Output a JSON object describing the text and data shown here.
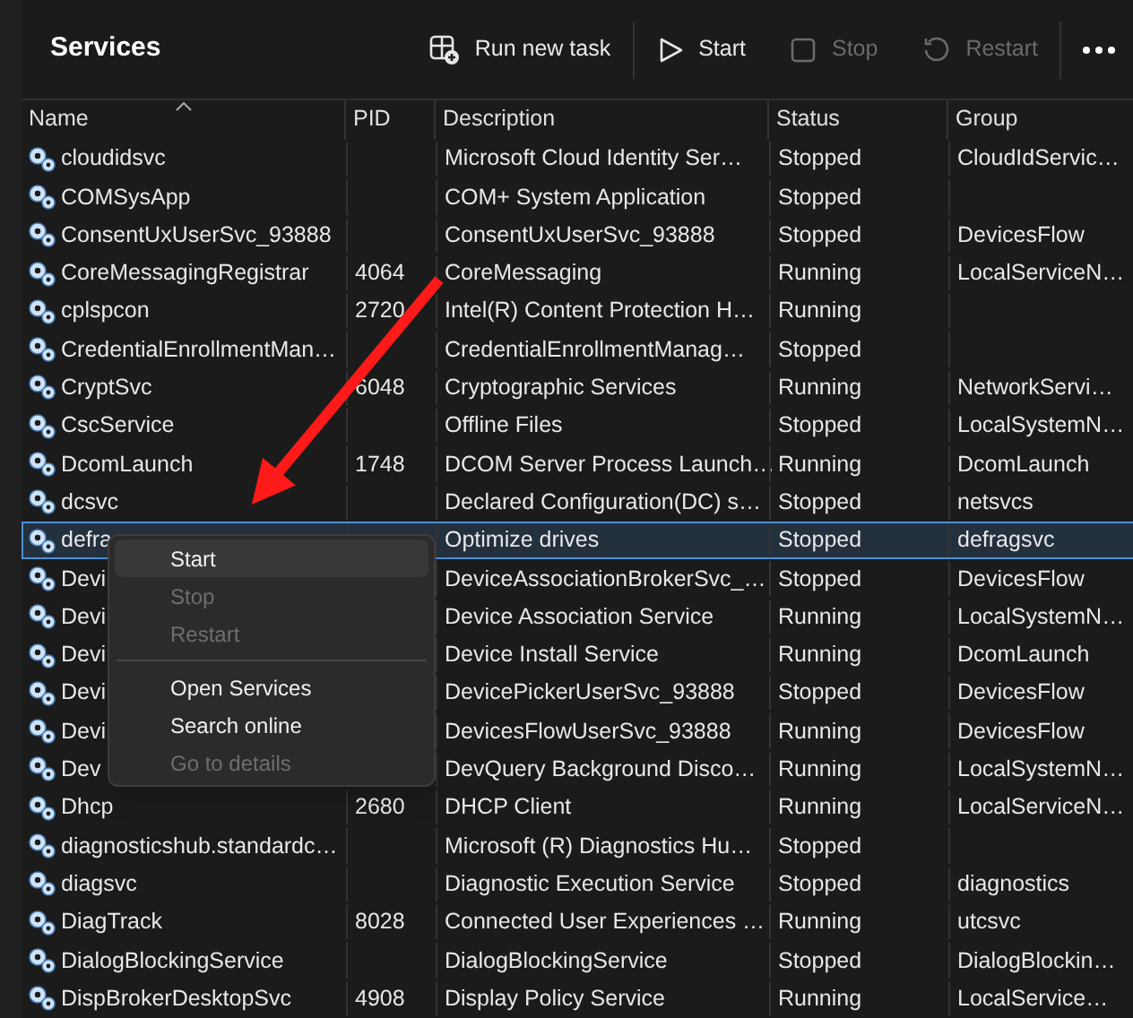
{
  "title": "Services",
  "toolbar": [
    {
      "label": "Run new task",
      "disabled": false
    },
    {
      "label": "Start",
      "disabled": false
    },
    {
      "label": "Stop",
      "disabled": true
    },
    {
      "label": "Restart",
      "disabled": true
    }
  ],
  "columns": [
    "Name",
    "PID",
    "Description",
    "Status",
    "Group"
  ],
  "rows": [
    {
      "name": "cloudidsvc",
      "pid": "",
      "description": "Microsoft Cloud Identity Ser…",
      "status": "Stopped",
      "group": "CloudIdServic…",
      "selected": false
    },
    {
      "name": "COMSysApp",
      "pid": "",
      "description": "COM+ System Application",
      "status": "Stopped",
      "group": "",
      "selected": false
    },
    {
      "name": "ConsentUxUserSvc_93888",
      "pid": "",
      "description": "ConsentUxUserSvc_93888",
      "status": "Stopped",
      "group": "DevicesFlow",
      "selected": false
    },
    {
      "name": "CoreMessagingRegistrar",
      "pid": "4064",
      "description": "CoreMessaging",
      "status": "Running",
      "group": "LocalServiceN…",
      "selected": false
    },
    {
      "name": "cplspcon",
      "pid": "2720",
      "description": "Intel(R) Content Protection H…",
      "status": "Running",
      "group": "",
      "selected": false
    },
    {
      "name": "CredentialEnrollmentMan…",
      "pid": "",
      "description": "CredentialEnrollmentManag…",
      "status": "Stopped",
      "group": "",
      "selected": false
    },
    {
      "name": "CryptSvc",
      "pid": "6048",
      "description": "Cryptographic Services",
      "status": "Running",
      "group": "NetworkServi…",
      "selected": false
    },
    {
      "name": "CscService",
      "pid": "",
      "description": "Offline Files",
      "status": "Stopped",
      "group": "LocalSystemN…",
      "selected": false
    },
    {
      "name": "DcomLaunch",
      "pid": "1748",
      "description": "DCOM Server Process Launch…",
      "status": "Running",
      "group": "DcomLaunch",
      "selected": false
    },
    {
      "name": "dcsvc",
      "pid": "",
      "description": "Declared Configuration(DC) s…",
      "status": "Stopped",
      "group": "netsvcs",
      "selected": false
    },
    {
      "name": "defra",
      "pid": "",
      "description": "Optimize drives",
      "status": "Stopped",
      "group": "defragsvc",
      "selected": true
    },
    {
      "name": "Devi",
      "pid": "",
      "description": "DeviceAssociationBrokerSvc_…",
      "status": "Stopped",
      "group": "DevicesFlow",
      "selected": false
    },
    {
      "name": "Devi",
      "pid": "",
      "description": "Device Association Service",
      "status": "Running",
      "group": "LocalSystemN…",
      "selected": false
    },
    {
      "name": "Devi",
      "pid": "",
      "description": "Device Install Service",
      "status": "Running",
      "group": "DcomLaunch",
      "selected": false
    },
    {
      "name": "Devi",
      "pid": "",
      "description": "DevicePickerUserSvc_93888",
      "status": "Stopped",
      "group": "DevicesFlow",
      "selected": false
    },
    {
      "name": "Devi",
      "pid": "",
      "description": "DevicesFlowUserSvc_93888",
      "status": "Running",
      "group": "DevicesFlow",
      "selected": false
    },
    {
      "name": "Dev",
      "pid": "",
      "description": "DevQuery Background Disco…",
      "status": "Running",
      "group": "LocalSystemN…",
      "selected": false
    },
    {
      "name": "Dhcp",
      "pid": "2680",
      "description": "DHCP Client",
      "status": "Running",
      "group": "LocalServiceN…",
      "selected": false
    },
    {
      "name": "diagnosticshub.standardc…",
      "pid": "",
      "description": "Microsoft (R) Diagnostics Hu…",
      "status": "Stopped",
      "group": "",
      "selected": false
    },
    {
      "name": "diagsvc",
      "pid": "",
      "description": "Diagnostic Execution Service",
      "status": "Stopped",
      "group": "diagnostics",
      "selected": false
    },
    {
      "name": "DiagTrack",
      "pid": "8028",
      "description": "Connected User Experiences …",
      "status": "Running",
      "group": "utcsvc",
      "selected": false
    },
    {
      "name": "DialogBlockingService",
      "pid": "",
      "description": "DialogBlockingService",
      "status": "Stopped",
      "group": "DialogBlockin…",
      "selected": false
    },
    {
      "name": "DispBrokerDesktopSvc",
      "pid": "4908",
      "description": "Display Policy Service",
      "status": "Running",
      "group": "LocalService…",
      "selected": false
    }
  ],
  "context_menu": [
    {
      "kind": "item",
      "label": "Start",
      "disabled": false,
      "selected": true
    },
    {
      "kind": "item",
      "label": "Stop",
      "disabled": true,
      "selected": false
    },
    {
      "kind": "item",
      "label": "Restart",
      "disabled": true,
      "selected": false
    },
    {
      "kind": "separator"
    },
    {
      "kind": "item",
      "label": "Open Services",
      "disabled": false,
      "selected": false
    },
    {
      "kind": "item",
      "label": "Search online",
      "disabled": false,
      "selected": false
    },
    {
      "kind": "item",
      "label": "Go to details",
      "disabled": true,
      "selected": false
    }
  ]
}
